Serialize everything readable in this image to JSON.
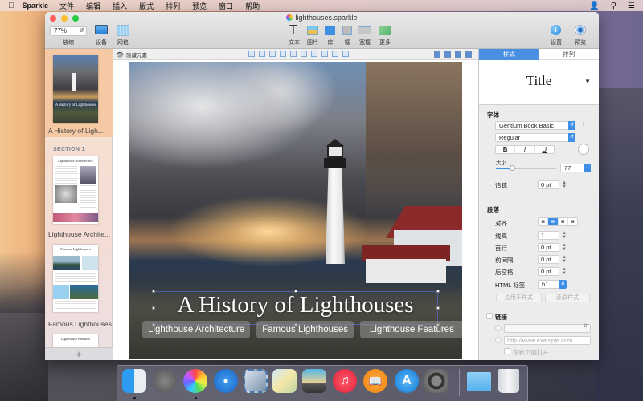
{
  "menubar": {
    "apple": "",
    "app_name": "Sparkle",
    "items": [
      "文件",
      "编辑",
      "插入",
      "版式",
      "排列",
      "预览",
      "窗口",
      "帮助"
    ],
    "right_icons": [
      "user-icon",
      "spotlight-search-icon",
      "notification-center-icon"
    ]
  },
  "window": {
    "title": "lighthouses.sparkle",
    "toolbar": {
      "zoom_value": "77%",
      "zoom_label": "放缩",
      "device_label": "设备",
      "grid_label": "网格",
      "text_label": "文本",
      "image_label": "图片",
      "library_label": "库",
      "box_label": "框",
      "widebox_label": "宽框",
      "more_label": "更多",
      "settings_label": "设置",
      "preview_label": "预览"
    }
  },
  "sidebar": {
    "pages": [
      {
        "label": "A History of Ligh...",
        "thumb_title": "A History of Lighthouses",
        "selected": true
      },
      {
        "label": "Lighthouse Archite...",
        "thumb_title": "Lighthouse Architecture",
        "selected": false
      },
      {
        "label": "Famous Lighthouses",
        "thumb_title": "Famous Lighthouses",
        "selected": false
      },
      {
        "label": "",
        "thumb_title": "Lighthouse Features",
        "selected": false
      }
    ],
    "section_header": "SECTION 1",
    "add_label": "+"
  },
  "canvas": {
    "hide_elements_label": "隐藏元素",
    "hero_title": "A History of Lighthouses",
    "nav_buttons": [
      "Lighthouse Architecture",
      "Famous Lighthouses",
      "Lighthouse Features"
    ]
  },
  "inspector": {
    "tabs": [
      {
        "label": "样式",
        "active": true
      },
      {
        "label": "排列",
        "active": false
      }
    ],
    "style_name": "Title",
    "font": {
      "header": "字体",
      "family": "Gentium Book Basic",
      "weight": "Regular",
      "bold": "B",
      "italic": "I",
      "underline": "U",
      "size_label": "大小",
      "size_value": "77",
      "size_slider_fraction": 0.27,
      "tracking_label": "追踪",
      "tracking_value": "0 pt"
    },
    "paragraph": {
      "header": "段落",
      "align_label": "对齐",
      "align_options": [
        "left",
        "center",
        "right",
        "justify"
      ],
      "align_selected": "center",
      "line_height_label": "线高",
      "line_height_value": "1",
      "first_line_label": "首行",
      "first_line_value": "0 pt",
      "space_before_label": "前间隔",
      "space_before_value": "0 pt",
      "space_after_label": "后空格",
      "space_after_value": "0 pt",
      "html_tag_label": "HTML 标签",
      "html_tag_value": "h1",
      "apply_style_button": "应用于样式",
      "revert_style_button": "还原样式"
    },
    "link": {
      "label": "链接",
      "url_placeholder": "http://www.example.com",
      "open_new_page_label": "在新页面打开"
    }
  },
  "dock": {
    "items": [
      "Finder",
      "Launchpad",
      "Sparkle",
      "Safari",
      "Mail",
      "Maps",
      "iPhoto",
      "iTunes",
      "iBooks",
      "App Store",
      "System Preferences",
      "Downloads",
      "Trash"
    ]
  }
}
